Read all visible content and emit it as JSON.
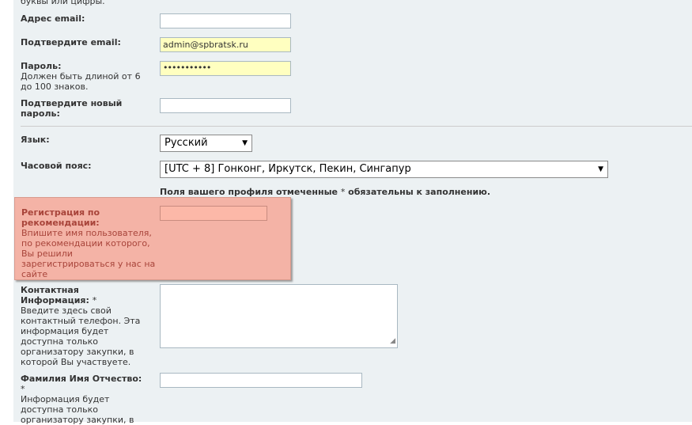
{
  "form": {
    "top_partial_text": "буквы или цифры.",
    "email": {
      "label": "Адрес email:",
      "value": ""
    },
    "confirm_email": {
      "label": "Подтвердите email:",
      "value": "admin@spbratsk.ru"
    },
    "password": {
      "label": "Пароль:",
      "desc": "Должен быть длиной от 6 до 100 знаков.",
      "value": "•••••••••••"
    },
    "confirm_password": {
      "label": "Подтвердите новый пароль:",
      "value": ""
    },
    "language": {
      "label": "Язык:",
      "selected": "Русский"
    },
    "timezone": {
      "label": "Часовой пояс:",
      "selected": "[UTC + 8] Гонконг, Иркутск, Пекин, Сингапур"
    },
    "required_note": {
      "text_before": "Поля вашего профиля отмеченные ",
      "star": "*",
      "text_after": " обязательны к заполнению."
    },
    "referral": {
      "label": "Регистрация по рекомендации:",
      "desc": "Впишите имя пользователя, по рекомендации которого, Вы решили зарегистрироваться у нас на сайте",
      "value": ""
    },
    "contact": {
      "label": "Контактная Информация:",
      "star": "*",
      "desc": "Введите здесь свой контактный телефон. Эта информация будет доступна только организатору закупки, в которой Вы участвуете.",
      "value": ""
    },
    "fullname": {
      "label": "Фамилия Имя Отчество:",
      "star": "*",
      "desc": "Информация будет доступна только организатору закупки, в",
      "value": ""
    }
  }
}
